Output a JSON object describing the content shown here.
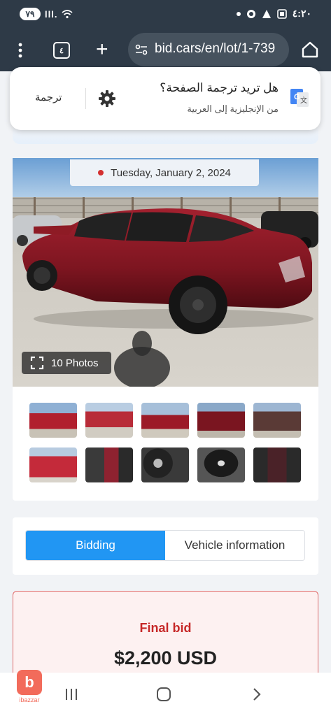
{
  "status_bar": {
    "battery": "٧٩",
    "signal": "lll.",
    "time": "٤:٢٠"
  },
  "browser": {
    "tab_count": "٤",
    "url": "bid.cars/en/lot/1-739"
  },
  "translate_prompt": {
    "title": "هل تريد ترجمة الصفحة؟",
    "subtitle": "من الإنجليزية إلى العربية",
    "translate_button": "ترجمة"
  },
  "listing": {
    "date": "Tuesday, January 2, 2024",
    "photos_button": "10 Photos",
    "thumbnail_count": 10
  },
  "tabs": [
    {
      "label": "Bidding",
      "active": true
    },
    {
      "label": "Vehicle information",
      "active": false
    }
  ],
  "final_bid": {
    "label": "Final bid",
    "value": "$2,200 USD"
  },
  "watermark": {
    "letter": "b",
    "text": "ibazzar"
  },
  "colors": {
    "toolbar": "#2e3a47",
    "accent": "#2196f3",
    "bid_label": "#c62828",
    "car": "#8e1b25"
  }
}
